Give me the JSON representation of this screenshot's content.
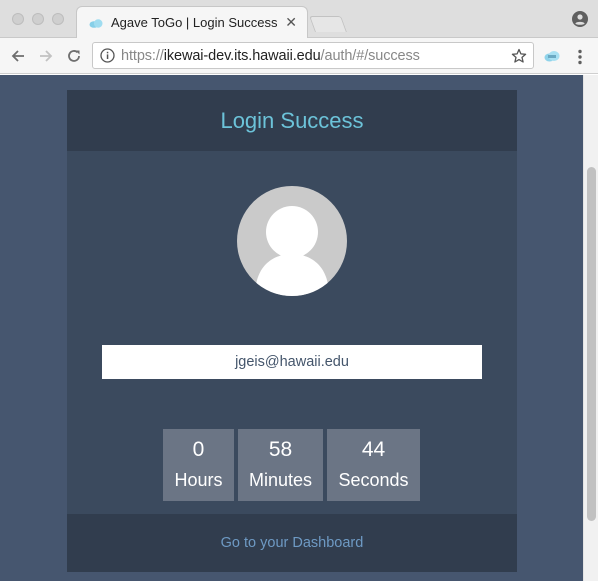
{
  "browser": {
    "tab": {
      "title": "Agave ToGo | Login Success",
      "close": "✕"
    },
    "address": {
      "protocol": "https://",
      "host": "ikewai-dev.its.hawaii.edu",
      "path": "/auth/#/success"
    }
  },
  "page": {
    "header": {
      "title": "Login Success"
    },
    "user": {
      "email": "jgeis@hawaii.edu"
    },
    "countdown": {
      "hours": {
        "value": "0",
        "label": "Hours"
      },
      "minutes": {
        "value": "58",
        "label": "Minutes"
      },
      "seconds": {
        "value": "44",
        "label": "Seconds"
      }
    },
    "footer": {
      "link_label": "Go to your Dashboard"
    }
  },
  "colors": {
    "page_background": "#46566f",
    "card_background": "#3b4a5e",
    "card_header_background": "#313d4e",
    "title_accent": "#6cc3d9",
    "countdown_box": "#6b7585",
    "link": "#6e9ac4"
  },
  "icons": [
    "cloud-favicon-icon",
    "close-icon",
    "profile-icon",
    "back-arrow-icon",
    "forward-arrow-icon",
    "reload-icon",
    "info-icon",
    "star-icon",
    "extension-icon",
    "menu-dots-icon",
    "user-avatar-icon"
  ]
}
